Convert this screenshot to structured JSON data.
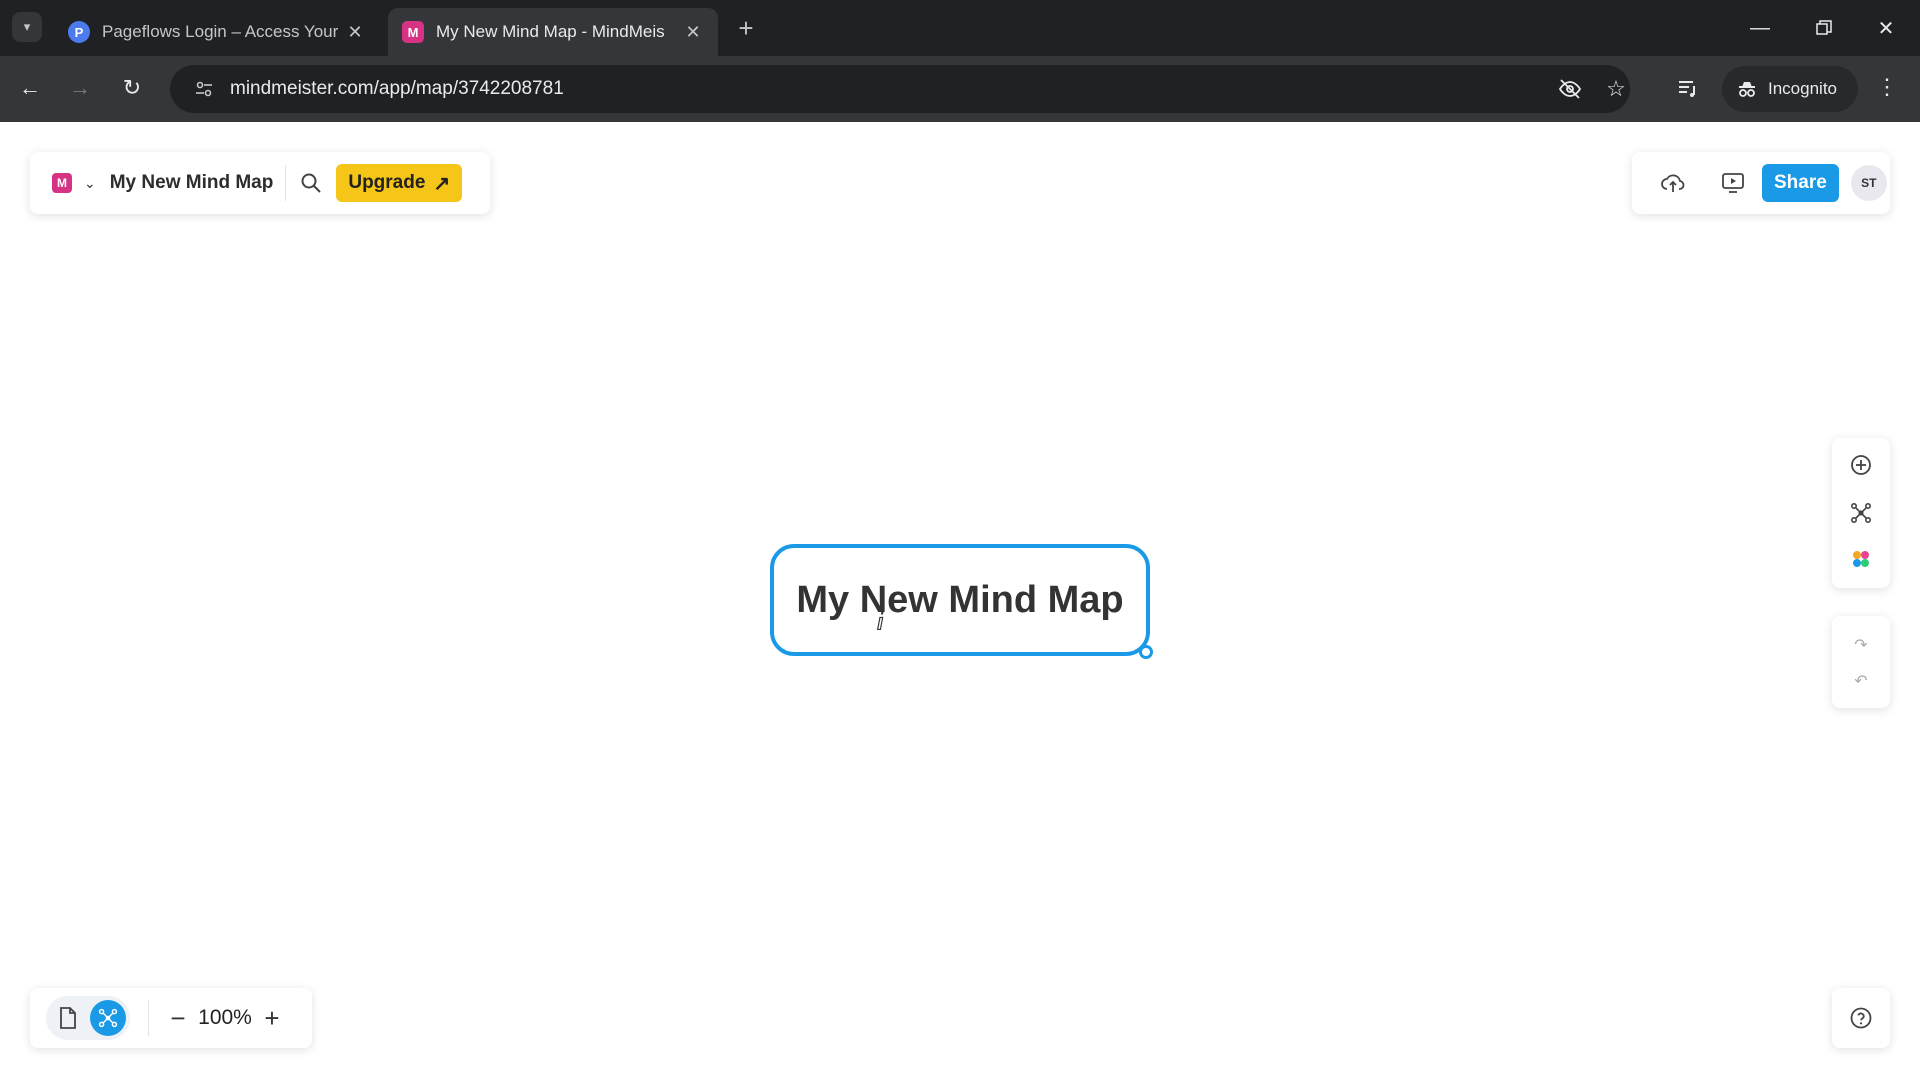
{
  "browser": {
    "tabs": [
      {
        "title": "Pageflows Login – Access Your",
        "favicon_letter": "P",
        "active": false
      },
      {
        "title": "My New Mind Map - MindMeis",
        "favicon_letter": "M",
        "active": true
      }
    ],
    "new_tab_label": "+",
    "url": "mindmeister.com/app/map/3742208781",
    "incognito_label": "Incognito"
  },
  "app": {
    "logo_letter": "M",
    "map_title": "My New Mind Map",
    "upgrade_label": "Upgrade",
    "upgrade_arrow": "↗",
    "share_label": "Share",
    "avatar_initials": "ST",
    "central_node_text": "My New Mind Map",
    "zoom_level": "100%",
    "zoom_out_label": "−",
    "zoom_in_label": "+"
  },
  "colors": {
    "accent": "#1a9ae6",
    "upgrade": "#f5c518",
    "brand": "#d63384"
  },
  "icons": [
    "tab-list-icon",
    "back-icon",
    "forward-icon",
    "reload-icon",
    "site-info-icon",
    "eye-off-icon",
    "star-icon",
    "reading-list-icon",
    "incognito-icon",
    "more-icon",
    "chevron-down-icon",
    "search-icon",
    "cloud-upload-icon",
    "present-icon",
    "add-topic-icon",
    "layout-icon",
    "theme-icon",
    "redo-icon",
    "undo-icon",
    "document-view-icon",
    "mindmap-view-icon",
    "help-icon"
  ]
}
